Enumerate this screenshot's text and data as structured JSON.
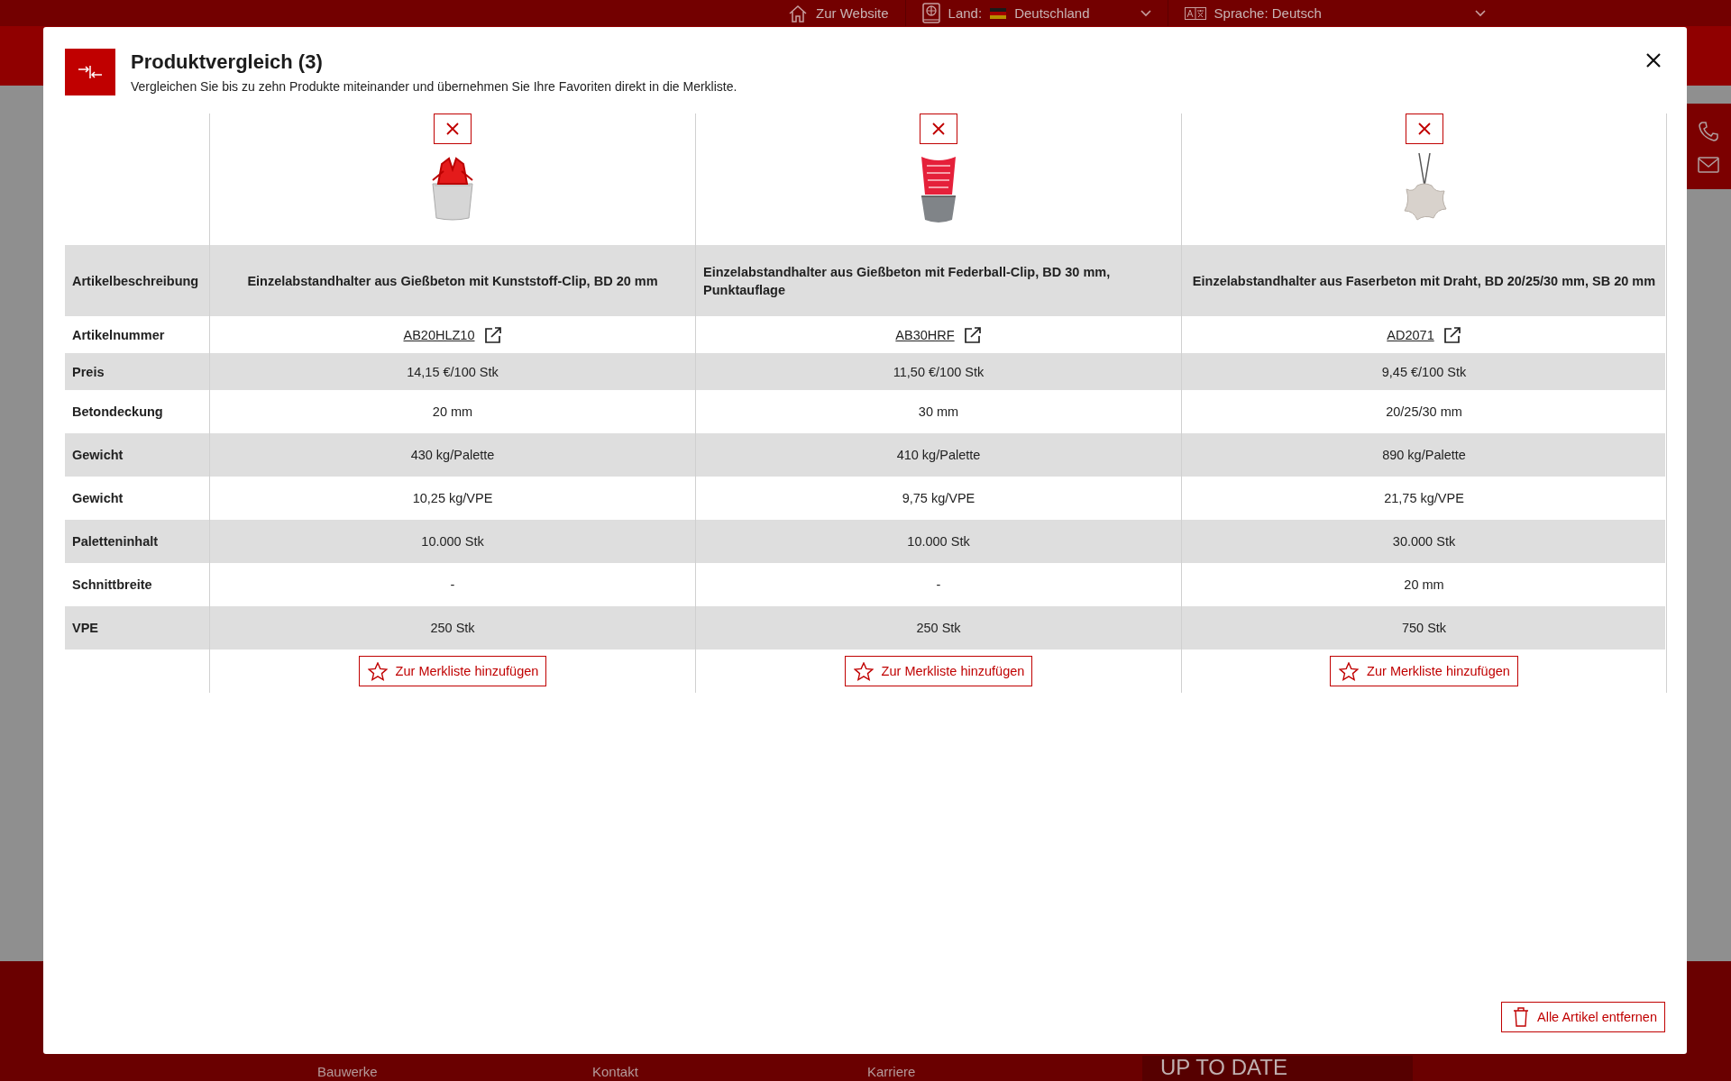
{
  "top_bar": {
    "website_link": "Zur Website",
    "country_label": "Land:",
    "country": "Deutschland",
    "language": "Sprache: Deutsch"
  },
  "footer": {
    "links": [
      "Bauwerke",
      "Kontakt",
      "Karriere"
    ],
    "banner": "UP TO DATE"
  },
  "modal": {
    "title": "Produktvergleich (3)",
    "subtitle": "Vergleichen Sie bis zu zehn Produkte miteinander und übernehmen Sie Ihre Favoriten direkt in die Merkliste.",
    "products": [
      {
        "kind": "clip-block",
        "article_number": "AB20HLZ10",
        "add_button": "Zur Merkliste hinzufügen"
      },
      {
        "kind": "cup-clip",
        "article_number": "AB30HRF",
        "add_button": "Zur Merkliste hinzufügen"
      },
      {
        "kind": "wire-block",
        "article_number": "AD2071",
        "add_button": "Zur Merkliste hinzufügen"
      }
    ],
    "rows": [
      {
        "label": "Artikelbeschreibung",
        "values": [
          "Einzelabstandhalter aus Gießbeton mit Kunststoff-Clip, BD 20 mm",
          "Einzelabstandhalter aus Gießbeton mit Federball-Clip, BD 30 mm, Punktauflage",
          "Einzelabstandhalter aus Faserbeton mit Draht, BD 20/25/30 mm, SB 20 mm"
        ]
      },
      {
        "label": "Artikelnummer",
        "kind": "link"
      },
      {
        "label": "Preis",
        "values": [
          "14,15 €/100 Stk",
          "11,50 €/100 Stk",
          "9,45 €/100 Stk"
        ]
      },
      {
        "label": "Betondeckung",
        "values": [
          "20 mm",
          "30 mm",
          "20/25/30 mm"
        ]
      },
      {
        "label": "Gewicht",
        "values": [
          "430 kg/Palette",
          "410 kg/Palette",
          "890 kg/Palette"
        ]
      },
      {
        "label": "Gewicht",
        "values": [
          "10,25 kg/VPE",
          "9,75 kg/VPE",
          "21,75 kg/VPE"
        ]
      },
      {
        "label": "Paletteninhalt",
        "values": [
          "10.000 Stk",
          "10.000 Stk",
          "30.000 Stk"
        ]
      },
      {
        "label": "Schnittbreite",
        "values": [
          "-",
          "-",
          "20 mm"
        ]
      },
      {
        "label": "VPE",
        "values": [
          "250 Stk",
          "250 Stk",
          "750 Stk"
        ]
      }
    ],
    "remove_all_button": "Alle Artikel entfernen"
  }
}
